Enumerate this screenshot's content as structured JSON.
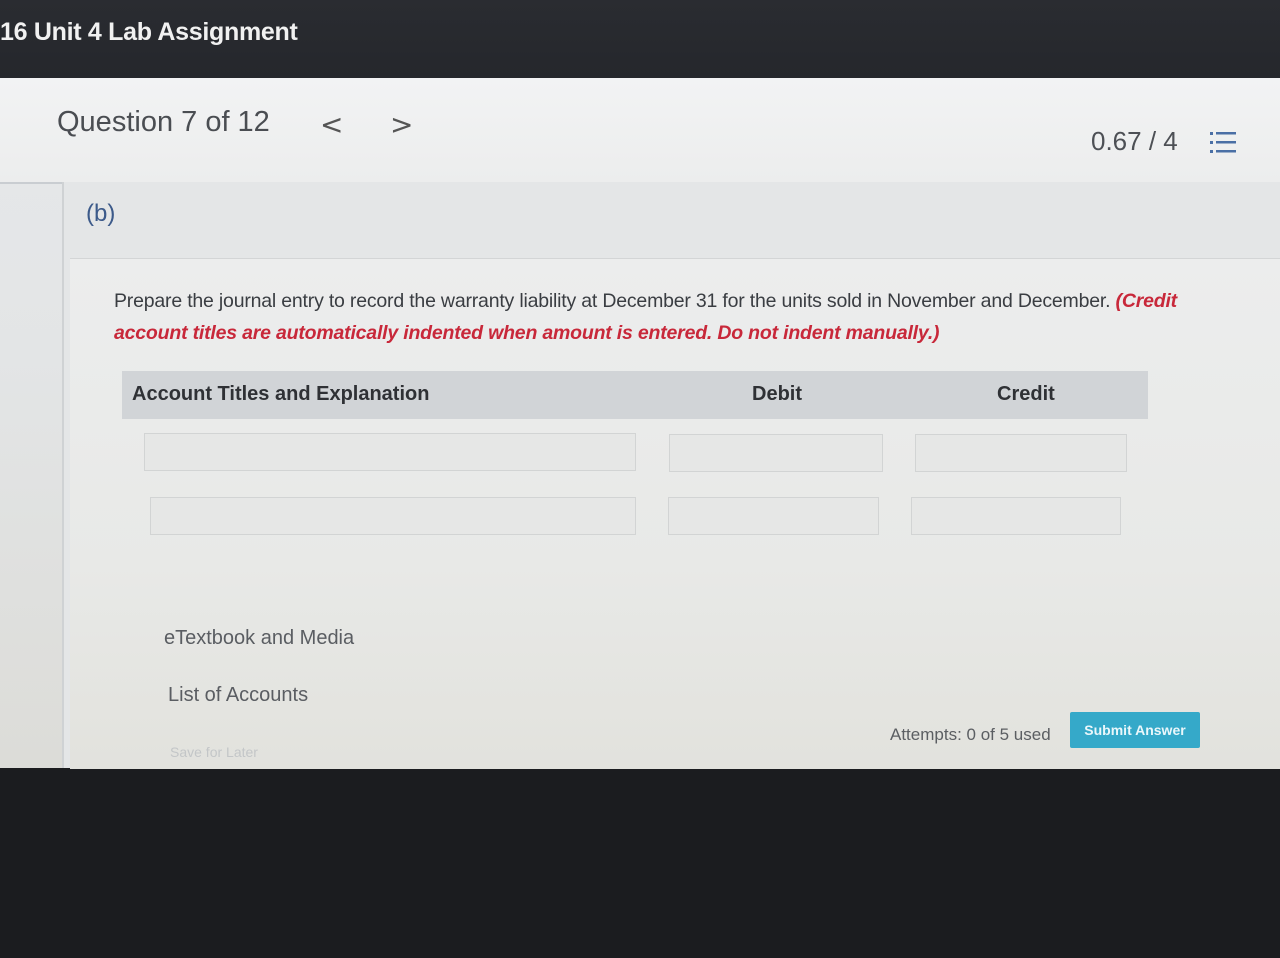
{
  "app": {
    "title": "16 Unit 4 Lab Assignment"
  },
  "question_header": {
    "label": "Question 7 of 12",
    "prev": "<",
    "next": ">",
    "score": "0.67 / 4",
    "list_icon": "list-icon"
  },
  "part": {
    "label": "(b)",
    "prompt": "Prepare the journal entry to record the warranty liability at December 31 for the units sold in November and December.",
    "note": "(Credit account titles are automatically indented when amount is entered. Do not indent manually.)"
  },
  "journal_table": {
    "headers": {
      "account": "Account Titles and Explanation",
      "debit": "Debit",
      "credit": "Credit"
    },
    "rows": [
      {
        "account": "",
        "debit": "",
        "credit": ""
      },
      {
        "account": "",
        "debit": "",
        "credit": ""
      }
    ]
  },
  "links": {
    "etextbook": "eTextbook and Media",
    "accounts": "List of Accounts"
  },
  "footer": {
    "save_later": "Save for Later",
    "attempts": "Attempts: 0 of 5 used",
    "submit": "Submit Answer"
  },
  "colors": {
    "accent": "#35a9c9",
    "note_red": "#c8283a",
    "part_blue": "#3c5a8a"
  }
}
